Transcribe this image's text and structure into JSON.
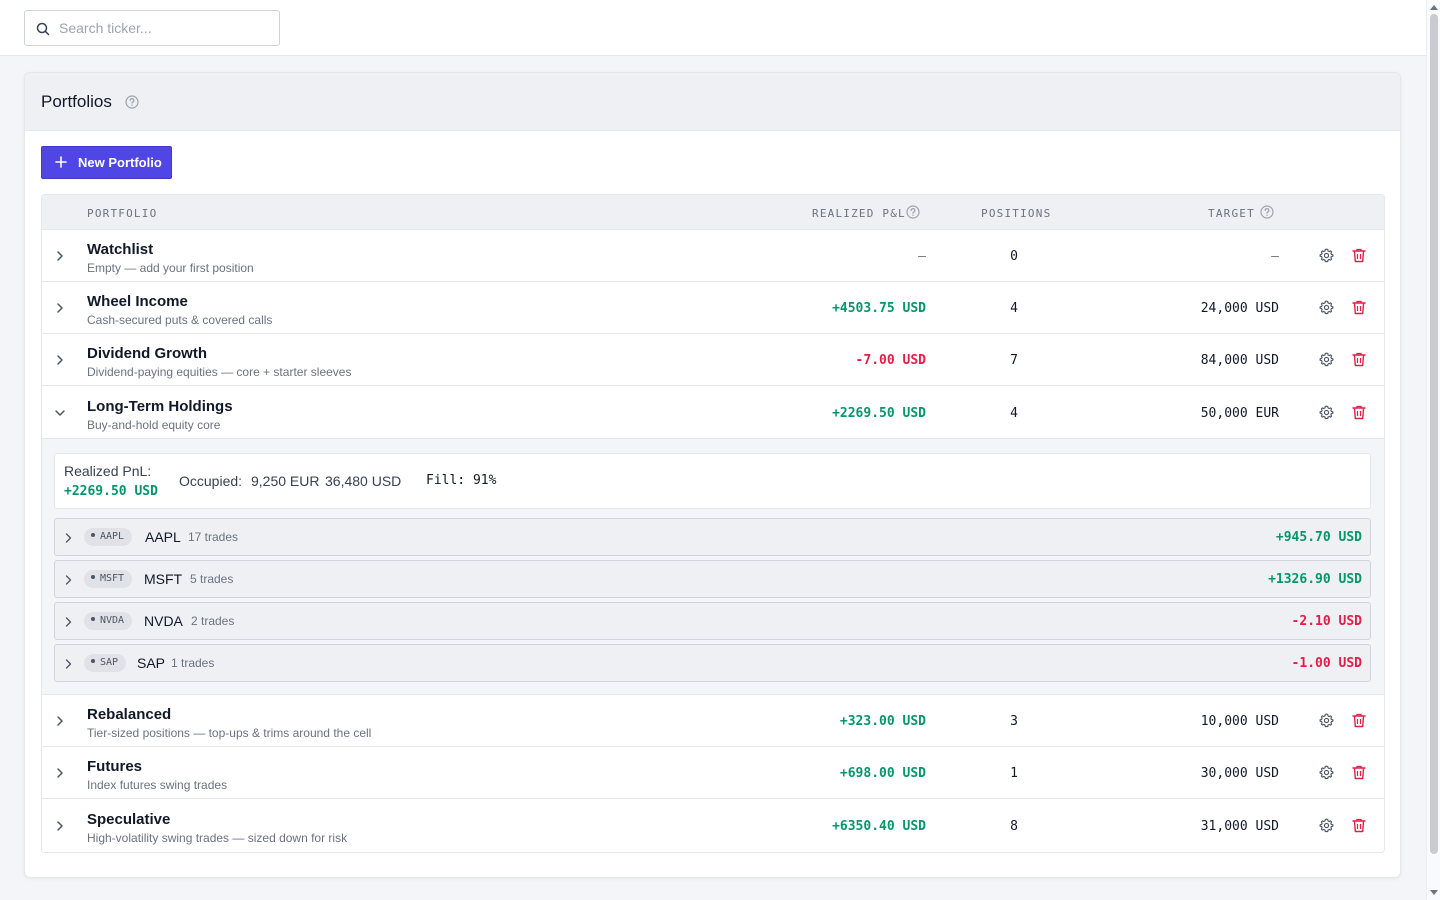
{
  "search": {
    "placeholder": "Search ticker..."
  },
  "card": {
    "title": "Portfolios",
    "new_button": "New Portfolio"
  },
  "table": {
    "headers": {
      "portfolio": "PORTFOLIO",
      "realized_pnl": "REALIZED P&L",
      "positions": "POSITIONS",
      "target": "TARGET"
    },
    "rows": [
      {
        "name": "Watchlist",
        "desc": "Empty — add your first position",
        "pnl": "—",
        "positions": "0",
        "target": "—"
      },
      {
        "name": "Wheel Income",
        "desc": "Cash-secured puts & covered calls",
        "pnl": "+4503.75 USD",
        "positions": "4",
        "target": "24,000 USD"
      },
      {
        "name": "Dividend Growth",
        "desc": "Dividend-paying equities — core + starter sleeves",
        "pnl": "-7.00 USD",
        "positions": "7",
        "target": "84,000 USD"
      },
      {
        "name": "Long-Term Holdings",
        "desc": "Buy-and-hold equity core",
        "pnl": "+2269.50 USD",
        "positions": "4",
        "target": "50,000 EUR"
      },
      {
        "name": "Rebalanced",
        "desc": "Tier-sized positions — top-ups & trims around the cell",
        "pnl": "+323.00 USD",
        "positions": "3",
        "target": "10,000 USD"
      },
      {
        "name": "Futures",
        "desc": "Index futures swing trades",
        "pnl": "+698.00 USD",
        "positions": "1",
        "target": "30,000 USD"
      },
      {
        "name": "Speculative",
        "desc": "High-volatility swing trades — sized down for risk",
        "pnl": "+6350.40 USD",
        "positions": "8",
        "target": "31,000 USD"
      }
    ]
  },
  "expanded": {
    "realized_label": "Realized PnL:",
    "realized_value": "+2269.50 USD",
    "occupied_label": "Occupied:",
    "occupied_eur": "9,250 EUR",
    "occupied_usd": "36,480 USD",
    "fill": "Fill: 91%",
    "positions": [
      {
        "badge": "AAPL",
        "ticker": "AAPL",
        "trades": "17 trades",
        "pnl": "+945.70 USD"
      },
      {
        "badge": "MSFT",
        "ticker": "MSFT",
        "trades": "5 trades",
        "pnl": "+1326.90 USD"
      },
      {
        "badge": "NVDA",
        "ticker": "NVDA",
        "trades": "2 trades",
        "pnl": "-2.10 USD"
      },
      {
        "badge": "SAP",
        "ticker": "SAP",
        "trades": "1 trades",
        "pnl": "-1.00 USD"
      }
    ]
  },
  "colors": {
    "accent": "#4f46e5",
    "positive": "#059669",
    "negative": "#e11d48",
    "danger_icon": "#e11d48"
  },
  "icons": [
    "search-icon",
    "help-icon",
    "plus-icon",
    "chevron-right-icon",
    "chevron-down-icon",
    "gear-icon",
    "trash-icon"
  ]
}
